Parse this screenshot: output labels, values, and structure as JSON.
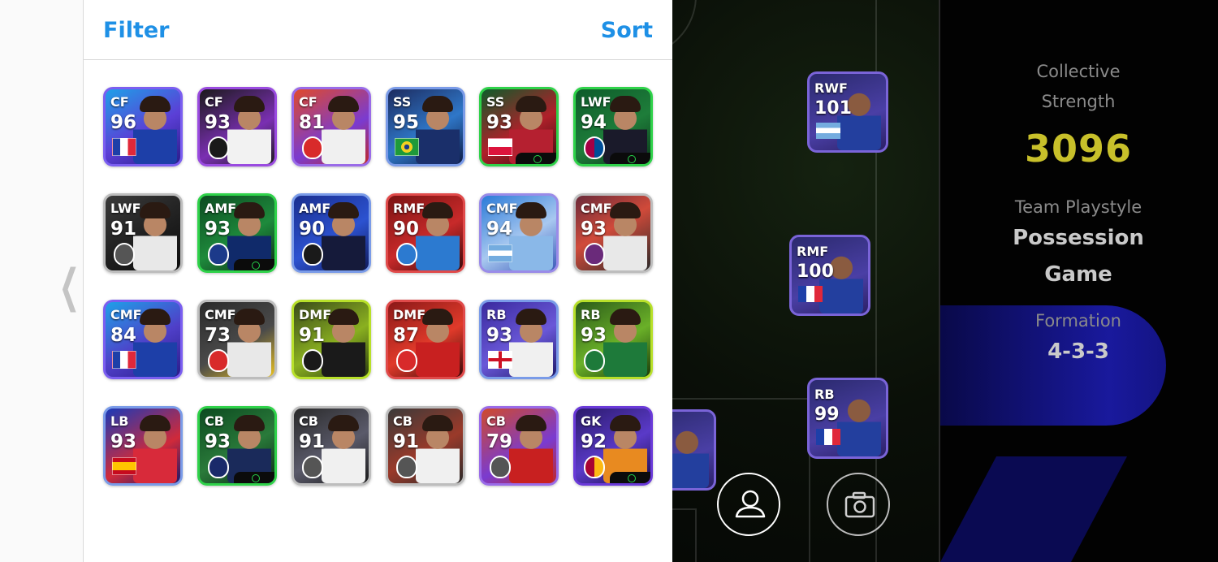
{
  "header": {
    "filter_label": "Filter",
    "sort_label": "Sort"
  },
  "colors": {
    "accent": "#1e90e6",
    "strength": "#c8c02a"
  },
  "cards": [
    {
      "pos": "CF",
      "ovr": "96",
      "mark": "flag-france",
      "frame": "#7b5ef0",
      "bg": "linear-gradient(150deg,#1ea0e8,#5b3fd6 55%,#2a1c88)",
      "shirt": "#1d3fa8"
    },
    {
      "pos": "CF",
      "ovr": "93",
      "mark": "badge-besiktas",
      "frame": "#9a4be0",
      "bg": "linear-gradient(150deg,#1a1a1a,#7a2fb2 60%,#1c1c1c)",
      "shirt": "#f2f2f2"
    },
    {
      "pos": "CF",
      "ovr": "81",
      "mark": "badge-toluca",
      "frame": "#9a6be8",
      "bg": "linear-gradient(150deg,#e04a2a,#7a3bd0 60%,#c02828)",
      "shirt": "#f0f0f0"
    },
    {
      "pos": "SS",
      "ovr": "95",
      "mark": "flag-brazil",
      "frame": "#7a9be8",
      "bg": "linear-gradient(150deg,#1c2a5e,#2f77c8 55%,#0c1a44)",
      "shirt": "#1a2f6a"
    },
    {
      "pos": "SS",
      "ovr": "93",
      "mark": "flag-poland",
      "frame": "#2fd24a",
      "bg": "linear-gradient(150deg,#0d5b2a,#b0202a 55%,#3a0c10)",
      "shirt": "#b52030"
    },
    {
      "pos": "LWF",
      "ovr": "94",
      "mark": "badge-barcelona",
      "frame": "#2fd24a",
      "bg": "linear-gradient(150deg,#0d5b2a,#1e7d3a 55%,#0a3a1a)",
      "shirt": "#1a1a2a"
    },
    {
      "pos": "LWF",
      "ovr": "91",
      "mark": "badge-generic",
      "frame": "#bdbdbd",
      "bg": "linear-gradient(150deg,#3a3a3a,#1f1f1f 55%,#0c0c0c)",
      "shirt": "#e8e8e8"
    },
    {
      "pos": "AMF",
      "ovr": "93",
      "mark": "badge-ennasr",
      "frame": "#2fd24a",
      "bg": "linear-gradient(150deg,#0c4a20,#1e8a3c 55%,#0b2a14)",
      "shirt": "#102a6a"
    },
    {
      "pos": "AMF",
      "ovr": "90",
      "mark": "badge-udinese",
      "frame": "#7a9be8",
      "bg": "linear-gradient(150deg,#1a2e8e,#2c52d0 55%,#101a5a)",
      "shirt": "#151a3a"
    },
    {
      "pos": "RMF",
      "ovr": "90",
      "mark": "badge-frontale",
      "frame": "#e04a4a",
      "bg": "linear-gradient(150deg,#7a1212,#c82a2a 55%,#3a0808)",
      "shirt": "#2c7ad0"
    },
    {
      "pos": "CMF",
      "ovr": "94",
      "mark": "flag-argentina",
      "frame": "#9a8be8",
      "bg": "linear-gradient(150deg,#2a7ad8,#a8c8f0 55%,#3a5ab8)",
      "shirt": "#8ab8e8"
    },
    {
      "pos": "CMF",
      "ovr": "93",
      "mark": "badge-valladolid",
      "frame": "#bdbdbd",
      "bg": "linear-gradient(150deg,#6a2a3a,#d04a3a 45%,#2a2a2a)",
      "shirt": "#e8e8e8"
    },
    {
      "pos": "CMF",
      "ovr": "84",
      "mark": "flag-france",
      "frame": "#7b5ef0",
      "bg": "linear-gradient(150deg,#1ea0e8,#4f3fc8 55%,#2a1c88)",
      "shirt": "#1d3fa8"
    },
    {
      "pos": "CMF",
      "ovr": "73",
      "mark": "badge-mainz",
      "frame": "#bdbdbd",
      "bg": "linear-gradient(150deg,#2a2a2a,#4a4a4a 55%,#e8c020)",
      "shirt": "#e8e8e8"
    },
    {
      "pos": "DMF",
      "ovr": "91",
      "mark": "badge-corinthians",
      "frame": "#b8e02a",
      "bg": "linear-gradient(150deg,#3a4a1a,#8ab020 55%,#2a3a10)",
      "shirt": "#1a1a1a"
    },
    {
      "pos": "DMF",
      "ovr": "87",
      "mark": "badge-manutd",
      "frame": "#e04a4a",
      "bg": "linear-gradient(150deg,#8a1818,#e03a2a 55%,#3a0808)",
      "shirt": "#c82020"
    },
    {
      "pos": "RB",
      "ovr": "93",
      "mark": "flag-england",
      "frame": "#7a9be8",
      "bg": "linear-gradient(150deg,#3a2a9e,#6a58d8 55%,#1f1a6a)",
      "shirt": "#f0f0f0"
    },
    {
      "pos": "RB",
      "ovr": "93",
      "mark": "badge-palmeiras",
      "frame": "#b8e02a",
      "bg": "linear-gradient(150deg,#2a5a1a,#6ab028 55%,#1a3a0a)",
      "shirt": "#1e7a3a"
    },
    {
      "pos": "LB",
      "ovr": "93",
      "mark": "flag-spain",
      "frame": "#7a9be8",
      "bg": "linear-gradient(150deg,#1a3ab8,#d02a3a 60%,#1a1a6a)",
      "shirt": "#d82a3a"
    },
    {
      "pos": "CB",
      "ovr": "93",
      "mark": "badge-psg",
      "frame": "#2fd24a",
      "bg": "linear-gradient(150deg,#0c4a20,#2a7a3a 55%,#0a2a14)",
      "shirt": "#1a2a5a"
    },
    {
      "pos": "CB",
      "ovr": "91",
      "mark": "badge-generic",
      "frame": "#bdbdbd",
      "bg": "linear-gradient(150deg,#2a2a2a,#5a5a6a 55%,#1a1a1a)",
      "shirt": "#f0f0f0"
    },
    {
      "pos": "CB",
      "ovr": "91",
      "mark": "badge-generic",
      "frame": "#bdbdbd",
      "bg": "linear-gradient(150deg,#3a3a3a,#9a3a2a 55%,#2a2a2a)",
      "shirt": "#f0f0f0"
    },
    {
      "pos": "CB",
      "ovr": "79",
      "mark": "badge-generic",
      "frame": "#9a6be8",
      "bg": "linear-gradient(150deg,#d04a2a,#7a3bd0 60%,#c02828)",
      "shirt": "#c82020"
    },
    {
      "pos": "GK",
      "ovr": "92",
      "mark": "badge-galatasaray",
      "frame": "#6a3ad8",
      "bg": "linear-gradient(150deg,#2a1a6a,#5a3ac8 55%,#1a0c4a)",
      "shirt": "#e88a20"
    }
  ],
  "field_cards": [
    {
      "pos": "RWF",
      "ovr": "101",
      "mark": "flag-argentina"
    },
    {
      "pos": "RMF",
      "ovr": "100",
      "mark": "flag-france"
    },
    {
      "pos": "RB",
      "ovr": "99",
      "mark": "flag-france"
    }
  ],
  "stats": {
    "strength_label_1": "Collective",
    "strength_label_2": "Strength",
    "strength_value": "3096",
    "playstyle_label": "Team Playstyle",
    "playstyle_value_1": "Possession",
    "playstyle_value_2": "Game",
    "formation_label": "Formation",
    "formation_value": "4-3-3"
  },
  "icons": {
    "back": "chevron-left-icon",
    "profile": "person-icon",
    "camera": "camera-icon"
  }
}
